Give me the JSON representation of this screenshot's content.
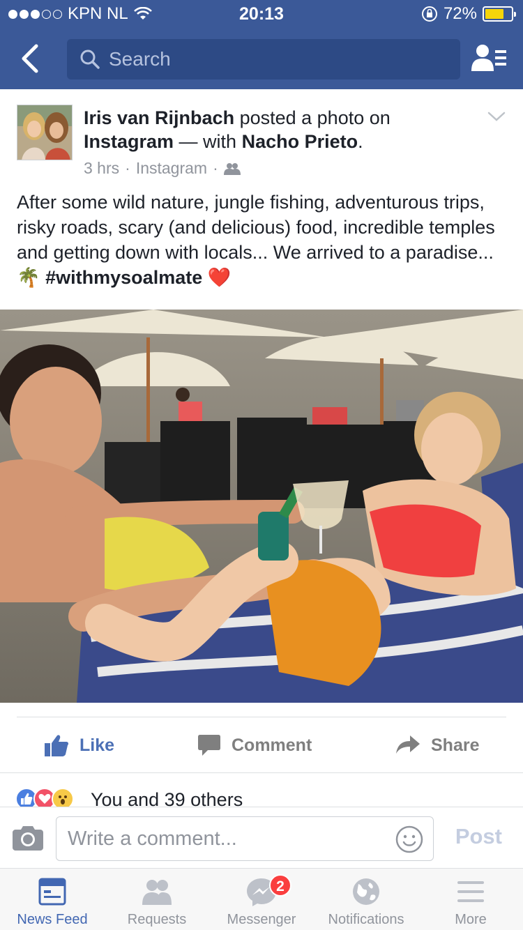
{
  "status_bar": {
    "carrier": "KPN NL",
    "time": "20:13",
    "battery": "72%",
    "battery_level": 0.72
  },
  "nav": {
    "search_placeholder": "Search"
  },
  "post": {
    "author": "Iris van Rijnbach",
    "action_text": " posted a photo on ",
    "app": "Instagram",
    "with_text": " — with ",
    "tagged": "Nacho Prieto",
    "period": ".",
    "time_ago": "3 hrs",
    "separator": "·",
    "source": "Instagram",
    "separator2": "·",
    "body_text": "After some wild nature, jungle fishing, adventurous trips, risky roads, scary (and delicious) food, incredible temples and getting down with locals... We arrived to a paradise... ",
    "emoji_palm": "🌴",
    "hashtag": "#withmysoalmate",
    "emoji_heart": "❤️"
  },
  "actions": {
    "like": "Like",
    "comment": "Comment",
    "share": "Share"
  },
  "reactions": {
    "text": "You and 39 others"
  },
  "comment_bar": {
    "placeholder": "Write a comment...",
    "post": "Post"
  },
  "tabs": [
    {
      "label": "News Feed"
    },
    {
      "label": "Requests"
    },
    {
      "label": "Messenger",
      "badge": "2"
    },
    {
      "label": "Notifications"
    },
    {
      "label": "More"
    }
  ],
  "colors": {
    "brand": "#3b5998",
    "link": "#4267b2",
    "badge": "#fa3e3e",
    "battery_fill": "#f5d50a"
  }
}
